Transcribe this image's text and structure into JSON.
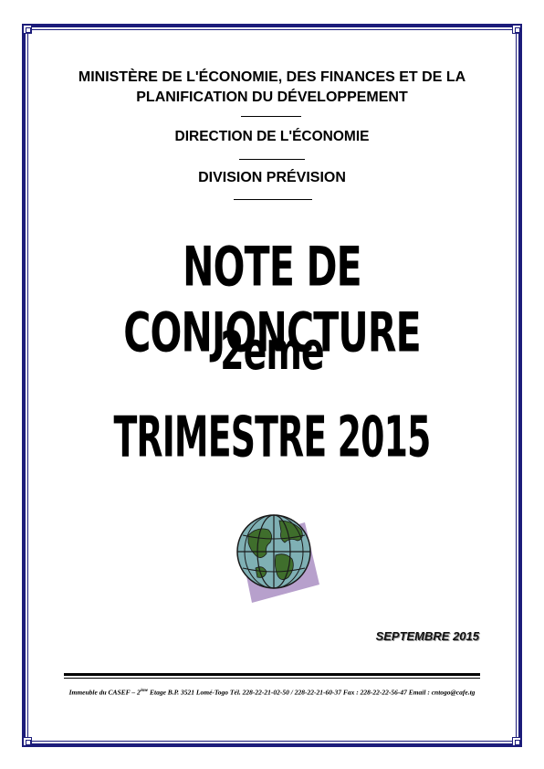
{
  "header": {
    "ministry": "MINISTÈRE DE L'ÉCONOMIE, DES FINANCES ET DE LA PLANIFICATION DU DÉVELOPPEMENT",
    "direction": "DIRECTION DE L'ÉCONOMIE",
    "division": "DIVISION PRÉVISION"
  },
  "title": {
    "line1": "NOTE DE  CONJONCTURE",
    "line2": "2eme",
    "line3": "TRIMESTRE  2015"
  },
  "date": "SEPTEMBRE 2015",
  "footer": {
    "prefix": "Immeuble du CASEF – 2",
    "sup": "ème",
    "rest": " Etage B.P. 3521 Lomé-Togo Tél. 228-22-21-02-50 / 228-22-21-60-37  Fax : 228-22-22-56-47 Email : cntogo@cafe.tg"
  },
  "colors": {
    "border": "#1c1c7a",
    "globe_shadow": "#b7a0cc",
    "globe_ocean": "#7fb0b4",
    "globe_land": "#3f6e2c"
  },
  "icons": {
    "globe": "globe-icon"
  }
}
